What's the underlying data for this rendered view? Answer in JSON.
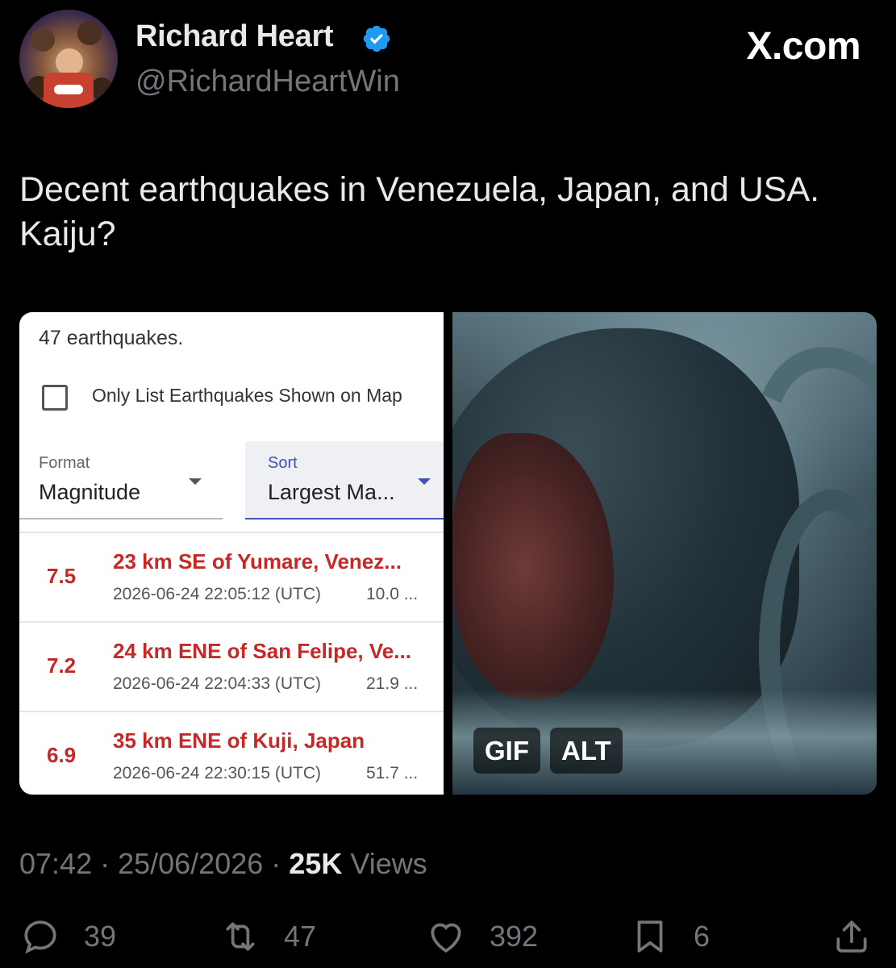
{
  "author": {
    "name": "Richard Heart",
    "handle": "@RichardHeartWin",
    "verified": true,
    "avatar": "avatar-photo"
  },
  "brand": "X.com",
  "tweet": {
    "text": "Decent earthquakes in Venezuela, Japan, and USA. Kaiju?"
  },
  "media": {
    "earthquake_panel": {
      "count_text": "47 earthquakes.",
      "checkbox_label": "Only List Earthquakes Shown on Map",
      "checkbox_checked": false,
      "format": {
        "label": "Format",
        "value": "Magnitude"
      },
      "sort": {
        "label": "Sort",
        "value": "Largest Ma..."
      },
      "items": [
        {
          "magnitude": "7.5",
          "place": "23 km SE of Yumare, Venez...",
          "time": "2026-06-24 22:05:12 (UTC)",
          "depth": "10.0 ..."
        },
        {
          "magnitude": "7.2",
          "place": "24 km ENE of San Felipe, Ve...",
          "time": "2026-06-24 22:04:33 (UTC)",
          "depth": "21.9 ..."
        },
        {
          "magnitude": "6.9",
          "place": "35 km ENE of Kuji, Japan",
          "time": "2026-06-24 22:30:15 (UTC)",
          "depth": "51.7 ..."
        }
      ]
    },
    "gif": {
      "badges": {
        "gif": "GIF",
        "alt": "ALT"
      }
    }
  },
  "meta": {
    "time": "07:42",
    "separator": " · ",
    "date": "25/06/2026",
    "views_count": "25K",
    "views_label": " Views"
  },
  "actions": {
    "replies": "39",
    "reposts": "47",
    "likes": "392",
    "bookmarks": "6"
  },
  "colors": {
    "background": "#000000",
    "text_primary": "#e7e9ea",
    "text_secondary": "#71767b",
    "verified_badge": "#1d9bf0",
    "quake_red": "#c62828",
    "sort_accent": "#3f51b5"
  }
}
